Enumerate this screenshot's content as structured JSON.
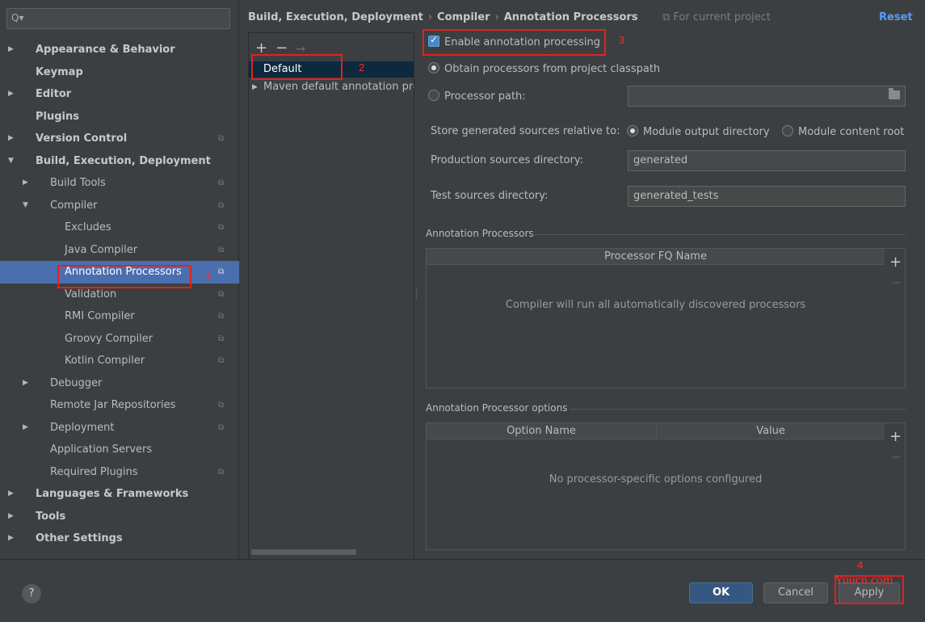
{
  "search": {
    "icon": "search-icon",
    "glyph": "Q▾"
  },
  "sidebar": {
    "items": [
      {
        "label": "Appearance & Behavior",
        "level": 0,
        "arrow": "▶",
        "bold": true,
        "project": false
      },
      {
        "label": "Keymap",
        "level": 0,
        "arrow": "",
        "bold": true,
        "project": false
      },
      {
        "label": "Editor",
        "level": 0,
        "arrow": "▶",
        "bold": true,
        "project": false
      },
      {
        "label": "Plugins",
        "level": 0,
        "arrow": "",
        "bold": true,
        "project": false
      },
      {
        "label": "Version Control",
        "level": 0,
        "arrow": "▶",
        "bold": true,
        "project": true
      },
      {
        "label": "Build, Execution, Deployment",
        "level": 0,
        "arrow": "▼",
        "bold": true,
        "project": false
      },
      {
        "label": "Build Tools",
        "level": 1,
        "arrow": "▶",
        "bold": false,
        "project": true
      },
      {
        "label": "Compiler",
        "level": 1,
        "arrow": "▼",
        "bold": false,
        "project": true
      },
      {
        "label": "Excludes",
        "level": 2,
        "arrow": "",
        "bold": false,
        "project": true
      },
      {
        "label": "Java Compiler",
        "level": 2,
        "arrow": "",
        "bold": false,
        "project": true
      },
      {
        "label": "Annotation Processors",
        "level": 2,
        "arrow": "",
        "bold": false,
        "project": true,
        "selected": true
      },
      {
        "label": "Validation",
        "level": 2,
        "arrow": "",
        "bold": false,
        "project": true
      },
      {
        "label": "RMI Compiler",
        "level": 2,
        "arrow": "",
        "bold": false,
        "project": true
      },
      {
        "label": "Groovy Compiler",
        "level": 2,
        "arrow": "",
        "bold": false,
        "project": true
      },
      {
        "label": "Kotlin Compiler",
        "level": 2,
        "arrow": "",
        "bold": false,
        "project": true
      },
      {
        "label": "Debugger",
        "level": 1,
        "arrow": "▶",
        "bold": false,
        "project": false
      },
      {
        "label": "Remote Jar Repositories",
        "level": 1,
        "arrow": "",
        "bold": false,
        "project": true
      },
      {
        "label": "Deployment",
        "level": 1,
        "arrow": "▶",
        "bold": false,
        "project": true
      },
      {
        "label": "Application Servers",
        "level": 1,
        "arrow": "",
        "bold": false,
        "project": false
      },
      {
        "label": "Required Plugins",
        "level": 1,
        "arrow": "",
        "bold": false,
        "project": true
      },
      {
        "label": "Languages & Frameworks",
        "level": 0,
        "arrow": "▶",
        "bold": true,
        "project": false
      },
      {
        "label": "Tools",
        "level": 0,
        "arrow": "▶",
        "bold": true,
        "project": false
      },
      {
        "label": "Other Settings",
        "level": 0,
        "arrow": "▶",
        "bold": true,
        "project": false
      }
    ],
    "project_glyph": "⧉"
  },
  "breadcrumb": {
    "parts": [
      "Build, Execution, Deployment",
      "Compiler",
      "Annotation Processors"
    ],
    "separator": "›",
    "for_project": "⧉ For current project",
    "reset": "Reset"
  },
  "profiles": {
    "add": "+",
    "remove": "−",
    "move": "→",
    "items": [
      {
        "label": "Default",
        "arrow": ""
      },
      {
        "label": "Maven default annotation processors profile",
        "arrow": "▶"
      }
    ]
  },
  "settings": {
    "enable_label": "Enable annotation processing",
    "enable_checked": true,
    "obtain_label": "Obtain processors from project classpath",
    "processor_path_label": "Processor path:",
    "processor_path_value": "",
    "store_label": "Store generated sources relative to:",
    "module_output": "Module output directory",
    "module_content": "Module content root",
    "production_label": "Production sources directory:",
    "production_value": "generated",
    "test_label": "Test sources directory:",
    "test_value": "generated_tests"
  },
  "processors_table": {
    "section": "Annotation Processors",
    "column": "Processor FQ Name",
    "empty": "Compiler will run all automatically discovered processors",
    "add": "+",
    "remove": "−"
  },
  "options_table": {
    "section": "Annotation Processor options",
    "columns": [
      "Option Name",
      "Value"
    ],
    "empty": "No processor-specific options configured",
    "add": "+",
    "remove": "−"
  },
  "annotations": [
    "1",
    "2",
    "3",
    "4"
  ],
  "footer": {
    "help": "?",
    "ok": "OK",
    "cancel": "Cancel",
    "apply": "Apply",
    "watermark": "Yuucn.com"
  },
  "colors": {
    "background": "#3c3f41",
    "selection": "#4b6eaf",
    "accent_link": "#589df6",
    "annotation_red": "#e32020"
  }
}
